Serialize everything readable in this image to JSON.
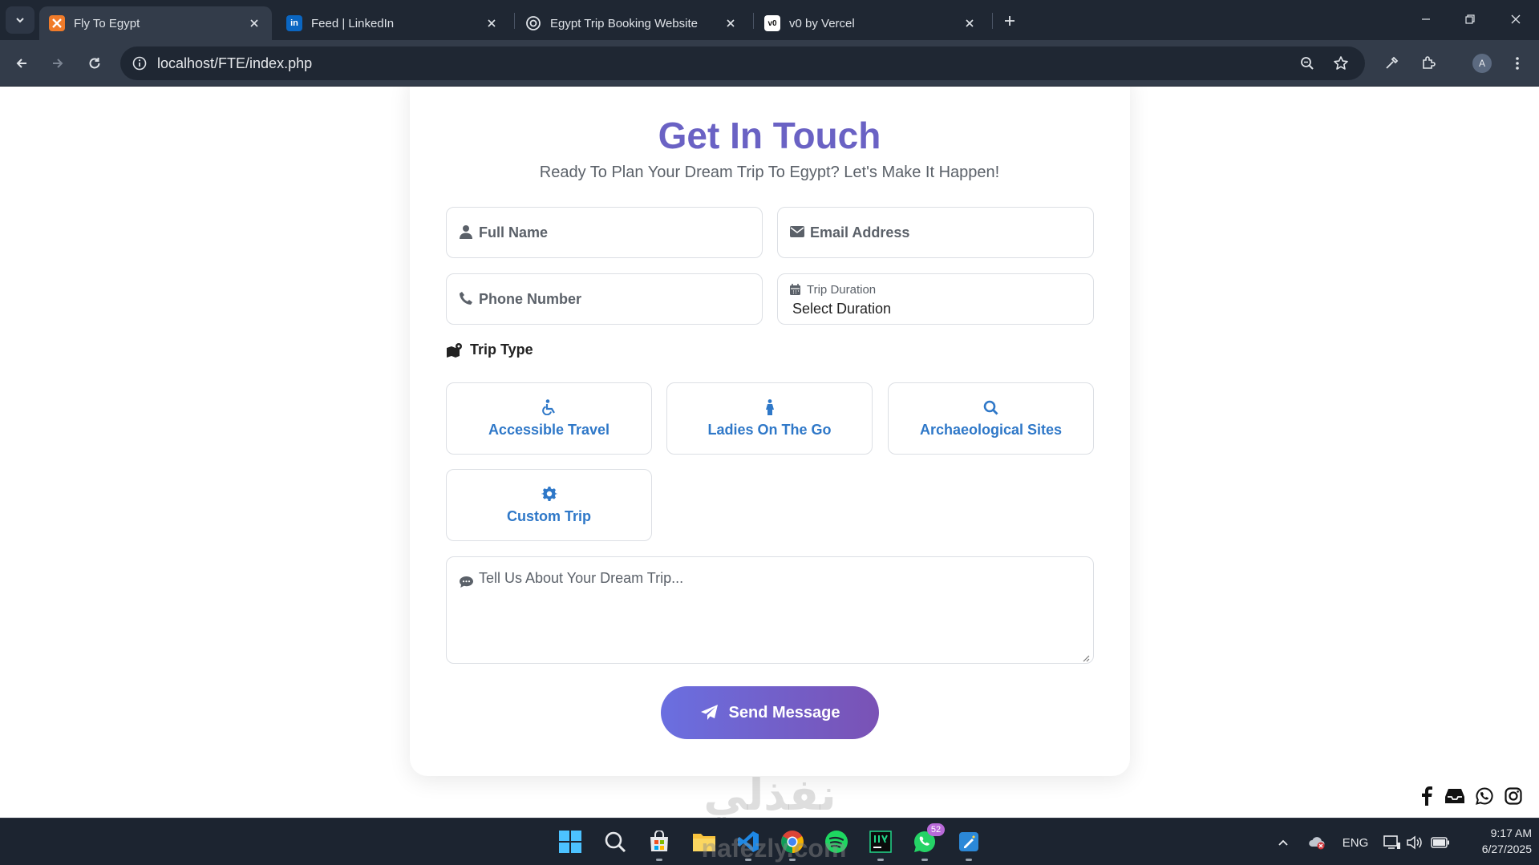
{
  "browser": {
    "tabs": [
      {
        "title": "Fly To Egypt",
        "favicon": "xampp-icon",
        "active": true
      },
      {
        "title": "Feed | LinkedIn",
        "favicon": "linkedin-icon",
        "active": false
      },
      {
        "title": "Egypt Trip Booking Website",
        "favicon": "openai-icon",
        "active": false
      },
      {
        "title": "v0 by Vercel",
        "favicon": "v0-icon",
        "active": false
      }
    ],
    "url": "localhost/FTE/index.php",
    "profile_initial": "A",
    "linkedin_favicon_text": "in",
    "v0_favicon_text": "v0"
  },
  "contact": {
    "title": "Get In Touch",
    "subtitle": "Ready To Plan Your Dream Trip To Egypt? Let's Make It Happen!",
    "full_name_placeholder": "Full Name",
    "email_placeholder": "Email Address",
    "phone_placeholder": "Phone Number",
    "duration_label": "Trip Duration",
    "duration_value": "Select Duration",
    "trip_type_label": "Trip Type",
    "trip_types": [
      {
        "label": "Accessible Travel",
        "icon": "wheelchair-icon"
      },
      {
        "label": "Ladies On The Go",
        "icon": "female-icon"
      },
      {
        "label": "Archaeological Sites",
        "icon": "search-icon"
      },
      {
        "label": "Custom Trip",
        "icon": "gear-icon"
      }
    ],
    "message_placeholder": "Tell Us About Your Dream Trip...",
    "send_label": "Send Message",
    "accent_color": "#6a62c4",
    "link_color": "#2f78c8"
  },
  "social": [
    "facebook-icon",
    "inbox-icon",
    "whatsapp-icon",
    "instagram-icon"
  ],
  "watermark": {
    "arabic": "نفذلي",
    "latin": "nafezly.com"
  },
  "taskbar": {
    "whatsapp_badge": "52",
    "language": "ENG",
    "time": "9:17 AM",
    "date": "6/27/2025"
  }
}
